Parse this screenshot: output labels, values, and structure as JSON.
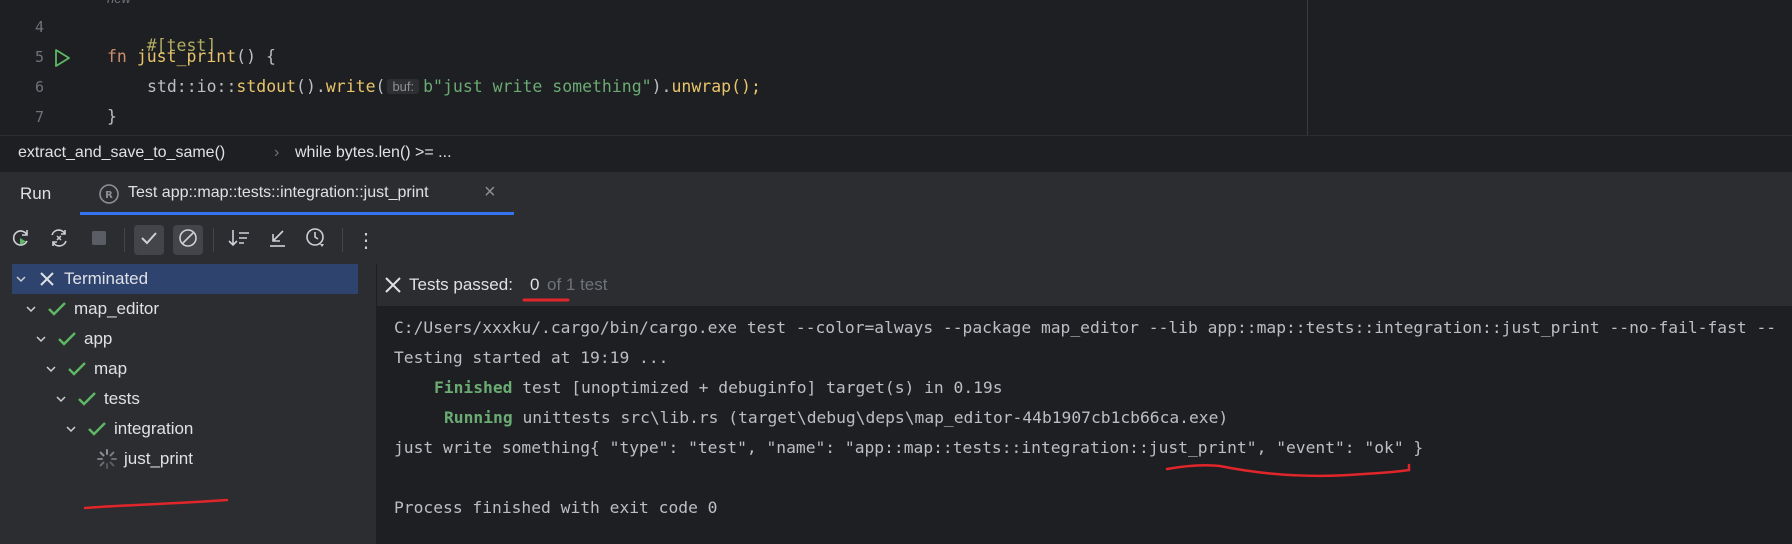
{
  "editor": {
    "hint": "new",
    "line_numbers": [
      "4",
      "5",
      "6",
      "7"
    ],
    "line4_attr": "#[test]",
    "line5_kw": "fn",
    "line5_name": "just_print",
    "line5_rest": "() {",
    "line6_std": "std::io::",
    "line6_stdout": "stdout",
    "line6_mid": "().",
    "line6_write": "write",
    "line6_paren": "(",
    "inlay_hint": "buf:",
    "line6_str": "b\"just write something\"",
    "line6_close": ").",
    "line6_unwrap": "unwrap",
    "line6_end": "();",
    "line7": "}"
  },
  "breadcrumb": {
    "item1": "extract_and_save_to_same()",
    "separator": "›",
    "item2": "while bytes.len() >= ..."
  },
  "run_panel": {
    "label": "Run",
    "tab_title": "Test app::map::tests::integration::just_print",
    "tab_close": "×"
  },
  "toolbar": {
    "more": "⋮"
  },
  "tree": {
    "items": [
      {
        "label": "Terminated"
      },
      {
        "label": "map_editor"
      },
      {
        "label": "app"
      },
      {
        "label": "map"
      },
      {
        "label": "tests"
      },
      {
        "label": "integration"
      },
      {
        "label": "just_print"
      }
    ]
  },
  "status": {
    "prefix": "Tests passed:",
    "count": "0",
    "suffix": "of 1 test"
  },
  "console": {
    "line1": "C:/Users/xxxku/.cargo/bin/cargo.exe test --color=always --package map_editor --lib app::map::tests::integration::just_print --no-fail-fast --",
    "line2": "Testing started at 19:19 ...",
    "line3_keyword": "Finished",
    "line3_rest": "test [unoptimized + debuginfo] target(s) in 0.19s",
    "line4_keyword": "Running",
    "line4_rest": "unittests src\\lib.rs (target\\debug\\deps\\map_editor-44b1907cb1cb66ca.exe)",
    "line5": "just write something{ \"type\": \"test\", \"name\": \"app::map::tests::integration::just_print\", \"event\": \"ok\" }",
    "line6": "Process finished with exit code 0"
  },
  "colors": {
    "accent": "#3574f0",
    "success": "#5fb865",
    "annotation": "#e0262a",
    "selection": "#2e436e"
  }
}
